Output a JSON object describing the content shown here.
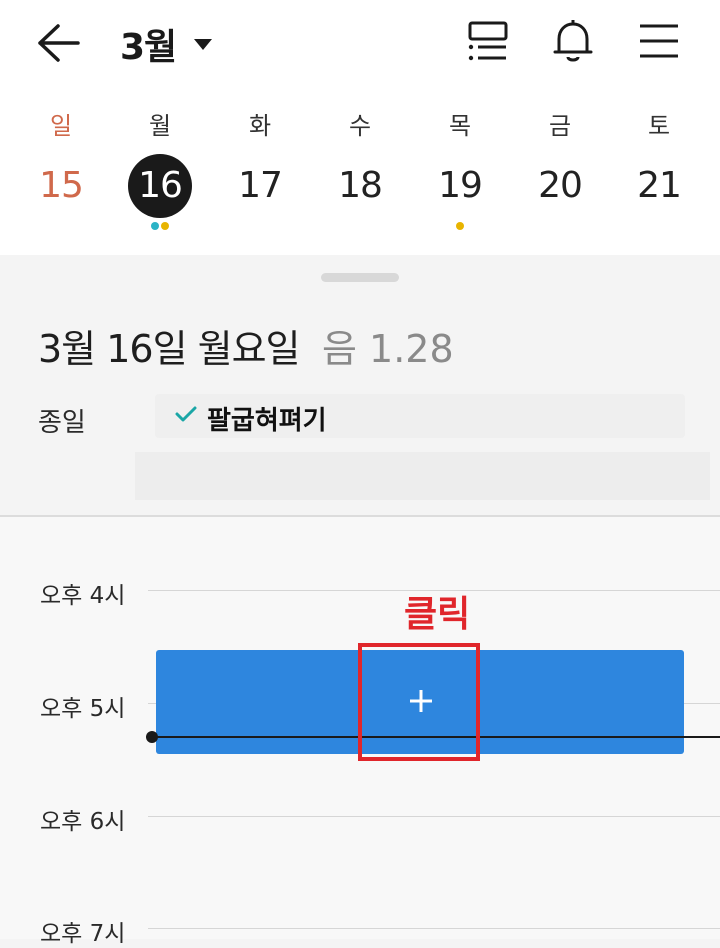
{
  "header": {
    "month": "3월",
    "icons": [
      "back-arrow-icon",
      "caret-down-icon",
      "list-view-icon",
      "bell-icon",
      "hamburger-menu-icon"
    ]
  },
  "week": {
    "days": [
      {
        "name": "일",
        "num": "15"
      },
      {
        "name": "월",
        "num": "16"
      },
      {
        "name": "화",
        "num": "17"
      },
      {
        "name": "수",
        "num": "18"
      },
      {
        "name": "목",
        "num": "19"
      },
      {
        "name": "금",
        "num": "20"
      },
      {
        "name": "토",
        "num": "21"
      }
    ],
    "selected_day": "16",
    "event_dots": {
      "16": [
        "#2bb3c6",
        "#e8b400"
      ],
      "19": [
        "#e8b400"
      ]
    }
  },
  "detail": {
    "date": "3월 16일 월요일",
    "lunar": "음  1.28",
    "allday_label": "종일",
    "allday_event": "팔굽혀펴기"
  },
  "timeline": {
    "hours": [
      "오후 4시",
      "오후 5시",
      "오후 6시",
      "오후 7시"
    ]
  },
  "annotation": {
    "label": "클릭"
  },
  "colors": {
    "sunday": "#d0694b",
    "selected_bg": "#1a1a1a",
    "new_event": "#2e86de",
    "check": "#1aa6a6",
    "annotation": "#e0262b"
  }
}
